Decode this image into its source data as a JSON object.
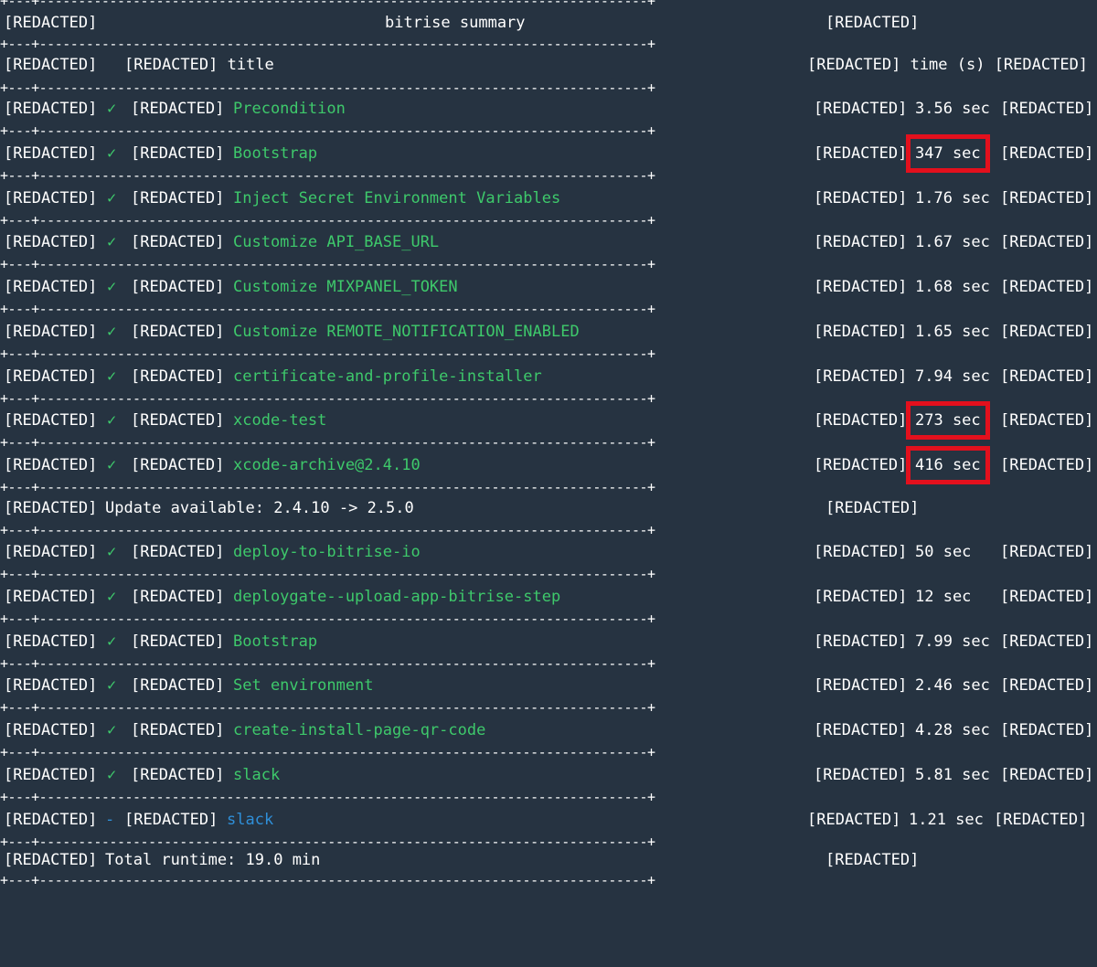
{
  "header": {
    "left": "[REDACTED]",
    "title": "bitrise summary",
    "right": "[REDACTED]"
  },
  "columns": {
    "left": "[REDACTED]",
    "mid": "[REDACTED] title",
    "right": "[REDACTED] time (s) [REDACTED]"
  },
  "separator_text": "+---+------------------------------------------------------------------------------+",
  "steps": [
    {
      "prefix": "[REDACTED]",
      "status": "✓",
      "tag": "[REDACTED]",
      "name": "Precondition",
      "time": "3.56 sec",
      "suffix": "[REDACTED]",
      "tagL": "[REDACTED]",
      "status_color": "green"
    },
    {
      "prefix": "[REDACTED]",
      "status": "✓",
      "tag": "[REDACTED]",
      "name": "Bootstrap",
      "time": "347 sec",
      "suffix": "[REDACTED]",
      "tagL": "[REDACTED]",
      "status_color": "green",
      "highlighted": true
    },
    {
      "prefix": "[REDACTED]",
      "status": "✓",
      "tag": "[REDACTED]",
      "name": "Inject Secret Environment Variables",
      "time": "1.76 sec",
      "suffix": "[REDACTED]",
      "tagL": "[REDACTED]",
      "status_color": "green"
    },
    {
      "prefix": "[REDACTED]",
      "status": "✓",
      "tag": "[REDACTED]",
      "name": "Customize API_BASE_URL",
      "time": "1.67 sec",
      "suffix": "[REDACTED]",
      "tagL": "[REDACTED]",
      "status_color": "green"
    },
    {
      "prefix": "[REDACTED]",
      "status": "✓",
      "tag": "[REDACTED]",
      "name": "Customize MIXPANEL_TOKEN",
      "time": "1.68 sec",
      "suffix": "[REDACTED]",
      "tagL": "[REDACTED]",
      "status_color": "green"
    },
    {
      "prefix": "[REDACTED]",
      "status": "✓",
      "tag": "[REDACTED]",
      "name": "Customize REMOTE_NOTIFICATION_ENABLED",
      "time": "1.65 sec",
      "suffix": "[REDACTED]",
      "tagL": "[REDACTED]",
      "status_color": "green"
    },
    {
      "prefix": "[REDACTED]",
      "status": "✓",
      "tag": "[REDACTED]",
      "name": "certificate-and-profile-installer",
      "time": "7.94 sec",
      "suffix": "[REDACTED]",
      "tagL": "[REDACTED]",
      "status_color": "green"
    },
    {
      "prefix": "[REDACTED]",
      "status": "✓",
      "tag": "[REDACTED]",
      "name": "xcode-test",
      "time": "273 sec",
      "suffix": "[REDACTED]",
      "tagL": "[REDACTED]",
      "status_color": "green",
      "highlighted": true
    },
    {
      "prefix": "[REDACTED]",
      "status": "✓",
      "tag": "[REDACTED]",
      "name": "xcode-archive@2.4.10",
      "time": "416 sec",
      "suffix": "[REDACTED]",
      "tagL": "[REDACTED]",
      "status_color": "green",
      "highlighted": true
    }
  ],
  "update_notice": {
    "prefix": "[REDACTED]",
    "text": "Update available: 2.4.10 -> 2.5.0",
    "suffix": "[REDACTED]"
  },
  "steps2": [
    {
      "prefix": "[REDACTED]",
      "status": "✓",
      "tag": "[REDACTED]",
      "name": "deploy-to-bitrise-io",
      "time": "50 sec",
      "suffix": "[REDACTED]",
      "tagL": "[REDACTED]",
      "status_color": "green"
    },
    {
      "prefix": "[REDACTED]",
      "status": "✓",
      "tag": "[REDACTED]",
      "name": "deploygate--upload-app-bitrise-step",
      "time": "12 sec",
      "suffix": "[REDACTED]",
      "tagL": "[REDACTED]",
      "status_color": "green"
    },
    {
      "prefix": "[REDACTED]",
      "status": "✓",
      "tag": "[REDACTED]",
      "name": "Bootstrap",
      "time": "7.99 sec",
      "suffix": "[REDACTED]",
      "tagL": "[REDACTED]",
      "status_color": "green"
    },
    {
      "prefix": "[REDACTED]",
      "status": "✓",
      "tag": "[REDACTED]",
      "name": "Set environment",
      "time": "2.46 sec",
      "suffix": "[REDACTED]",
      "tagL": "[REDACTED]",
      "status_color": "green"
    },
    {
      "prefix": "[REDACTED]",
      "status": "✓",
      "tag": "[REDACTED]",
      "name": "create-install-page-qr-code",
      "time": "4.28 sec",
      "suffix": "[REDACTED]",
      "tagL": "[REDACTED]",
      "status_color": "green"
    },
    {
      "prefix": "[REDACTED]",
      "status": "✓",
      "tag": "[REDACTED]",
      "name": "slack",
      "time": "5.81 sec",
      "suffix": "[REDACTED]",
      "tagL": "[REDACTED]",
      "status_color": "green"
    },
    {
      "prefix": "[REDACTED]",
      "status": "-",
      "tag": "[REDACTED]",
      "name": "slack",
      "time": "1.21 sec",
      "suffix": "[REDACTED]",
      "tagL": "[REDACTED]",
      "status_color": "blue"
    }
  ],
  "footer": {
    "prefix": "[REDACTED]",
    "text": "Total runtime: 19.0 min",
    "suffix": "[REDACTED]"
  },
  "colors": {
    "background": "#263341",
    "success_green": "#3ec96b",
    "skipped_blue": "#2f8fd8",
    "highlight_red": "#e3101d"
  }
}
